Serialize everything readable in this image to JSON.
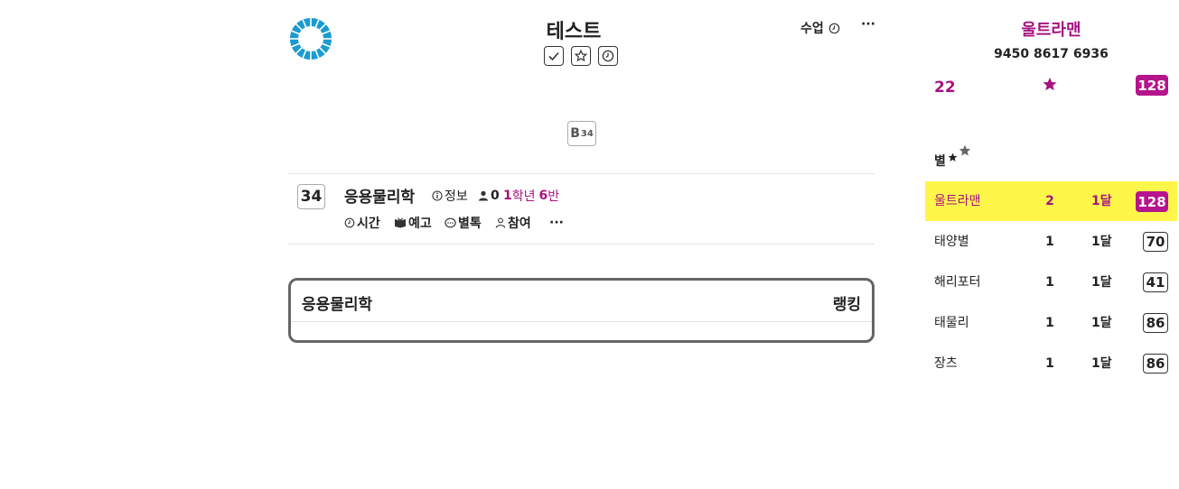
{
  "header": {
    "title": "테스트",
    "class_label": "수업",
    "more_label": "···",
    "icon_buttons": [
      "check-icon",
      "star-icon",
      "clock-icon"
    ]
  },
  "grade_badge": {
    "letter": "B",
    "sup": "34"
  },
  "course": {
    "number": "34",
    "name": "응용물리학",
    "info_label": "정보",
    "member_count": "0",
    "grade_num": "1",
    "grade_word": "학년",
    "class_num": "6",
    "class_word": "반",
    "actions": {
      "time": "시간",
      "preview": "예고",
      "chat": "별톡",
      "join": "참여",
      "more": "···"
    }
  },
  "panel": {
    "title": "응용물리학",
    "ranking_label": "랭킹"
  },
  "profile": {
    "name": "울트라맨",
    "phone": "9450 8617 6936",
    "left_value": "22",
    "score": "128"
  },
  "ranking": {
    "section_label": "별",
    "rows": [
      {
        "name": "울트라맨",
        "count": "2",
        "period": "1달",
        "score": "128",
        "highlight": true
      },
      {
        "name": "태양별",
        "count": "1",
        "period": "1달",
        "score": "70",
        "highlight": false
      },
      {
        "name": "해리포터",
        "count": "1",
        "period": "1달",
        "score": "41",
        "highlight": false
      },
      {
        "name": "태물리",
        "count": "1",
        "period": "1달",
        "score": "86",
        "highlight": false
      },
      {
        "name": "장츠",
        "count": "1",
        "period": "1달",
        "score": "86",
        "highlight": false
      }
    ]
  },
  "colors": {
    "accent": "#a8127f",
    "pill": "#b5148c",
    "highlight_row": "#fff64a",
    "logo": "#1b9bd1"
  }
}
